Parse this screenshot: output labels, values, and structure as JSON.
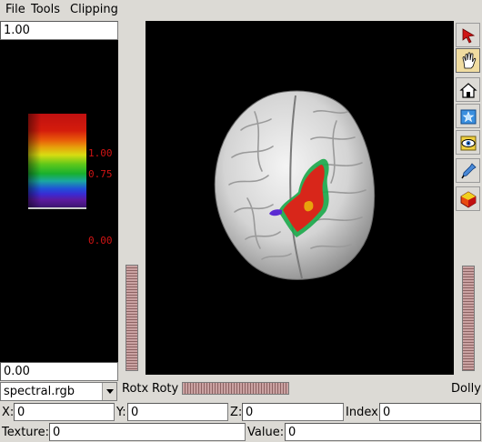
{
  "menu": {
    "file": "File",
    "tools": "Tools",
    "clipping": "Clipping"
  },
  "colorbar": {
    "max_entry": "1.00",
    "min_entry": "0.00",
    "tick_labels": [
      "1.00",
      "0.75",
      "0.00"
    ]
  },
  "colormap": {
    "selected": "spectral.rgb"
  },
  "controls": {
    "rotx": "Rotx",
    "roty": "Roty",
    "dolly": "Dolly"
  },
  "fields": {
    "x_label": "X:",
    "x_value": "0",
    "y_label": "Y:",
    "y_value": "0",
    "z_label": "Z:",
    "z_value": "0",
    "index_label": "Index:",
    "index_value": "0",
    "texture_label": "Texture:",
    "texture_value": "0",
    "value_label": "Value:",
    "value_value": "0"
  },
  "toolbar": {
    "tools": [
      "select-arrow-icon",
      "hand-pan-icon",
      "home-view-icon",
      "star-box-icon",
      "eye-view-icon",
      "dropper-icon",
      "color-cube-icon"
    ],
    "active_tool": "hand-pan-icon"
  },
  "colors": {
    "background": "#dcdad5",
    "viewport_bg": "#000000",
    "label_red": "#d01414",
    "active_tool": "#f0dca0"
  }
}
